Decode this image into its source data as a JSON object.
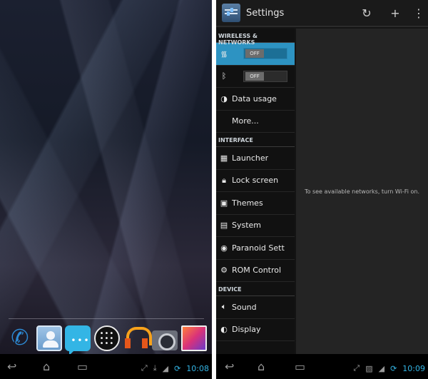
{
  "left_screen": {
    "dock": {
      "icons": [
        "phone-icon",
        "people-icon",
        "messaging-icon",
        "all-apps-icon",
        "play-music-icon",
        "camera-icon",
        "gallery-icon"
      ]
    },
    "statusbar": {
      "icons": [
        "fullscreen-icon",
        "download-icon",
        "signal-icon",
        "sync-icon"
      ],
      "clock": "10:08"
    }
  },
  "right_screen": {
    "actionbar": {
      "title": "Settings",
      "actions": [
        "sync-icon",
        "add-icon",
        "overflow-icon"
      ]
    },
    "sections": [
      {
        "header": "WIRELESS & NETWORKS"
      },
      {
        "header": "INTERFACE"
      },
      {
        "header": "DEVICE"
      }
    ],
    "wireless": {
      "wifi_toggle": "OFF",
      "bluetooth_toggle": "OFF",
      "data_usage": "Data usage",
      "more": "More..."
    },
    "interface": {
      "launcher": "Launcher",
      "lock_screen": "Lock screen",
      "themes": "Themes",
      "system": "System",
      "paranoid": "Paranoid Sett",
      "rom_control": "ROM Control"
    },
    "device": {
      "sound": "Sound",
      "display": "Display"
    },
    "detail_message": "To see available networks, turn Wi-Fi on.",
    "statusbar": {
      "icons": [
        "fullscreen-icon",
        "gallery-icon",
        "signal-icon",
        "sync-icon"
      ],
      "clock": "10:09"
    }
  },
  "colors": {
    "accent": "#33b5e5",
    "selected_row": "#2d93c2"
  }
}
